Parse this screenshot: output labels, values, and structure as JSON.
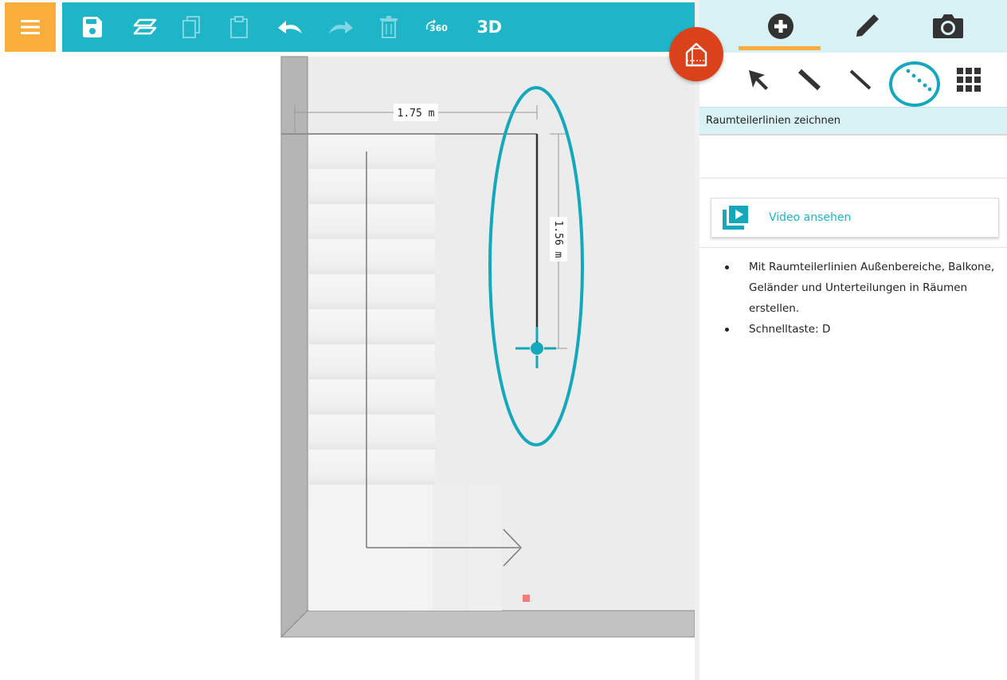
{
  "toolbar": {
    "menu_icon": "hamburger-icon",
    "buttons": [
      {
        "name": "save",
        "icon": "save-icon",
        "enabled": true
      },
      {
        "name": "levels",
        "icon": "layers-icon",
        "enabled": true
      },
      {
        "name": "copy",
        "icon": "copy-icon",
        "enabled": false
      },
      {
        "name": "paste",
        "icon": "paste-icon",
        "enabled": false
      },
      {
        "name": "undo",
        "icon": "undo-icon",
        "enabled": true
      },
      {
        "name": "redo",
        "icon": "redo-icon",
        "enabled": false
      },
      {
        "name": "delete",
        "icon": "trash-icon",
        "enabled": false
      },
      {
        "name": "view-360",
        "icon": "rotate-360-icon",
        "label": "360",
        "enabled": true
      },
      {
        "name": "view-3d",
        "label": "3D",
        "enabled": true
      }
    ],
    "accent_color": "#1eb5c9",
    "menu_color": "#fbad3b"
  },
  "canvas": {
    "dimension_horizontal": "1.75 m",
    "dimension_vertical": "1.56 m",
    "cursor_icon": "crosshair-icon",
    "marker_color": "#f27b7b",
    "highlight_color": "#14a8bd"
  },
  "floating_button": {
    "icon": "house-3d-icon",
    "color": "#d9421a"
  },
  "panel": {
    "tabs": [
      {
        "icon": "plus-circle-icon",
        "active": true
      },
      {
        "icon": "pencil-icon",
        "active": false
      },
      {
        "icon": "camera-icon",
        "active": false
      }
    ],
    "tools": [
      {
        "icon": "select-arrow-icon"
      },
      {
        "icon": "wall-line-icon"
      },
      {
        "icon": "room-line-icon"
      },
      {
        "icon": "divider-dotted-line-icon",
        "active": true
      },
      {
        "icon": "grid-icon"
      }
    ],
    "tool_title": "Raumteilerlinien zeichnen",
    "video": {
      "icon": "video-play-icon",
      "label": "Video ansehen"
    },
    "help_items": [
      "Mit Raumteilerlinien Außenbereiche, Balkone, Geländer und Unterteilungen in Räumen erstellen.",
      "Schnelltaste: D"
    ]
  }
}
